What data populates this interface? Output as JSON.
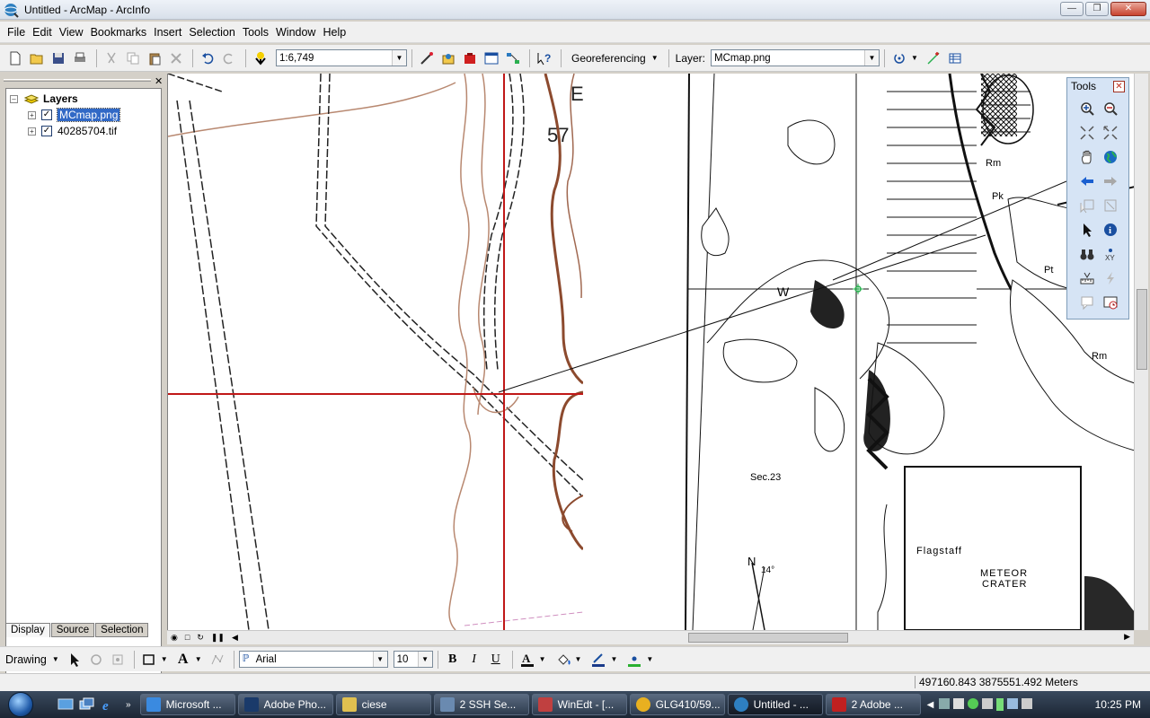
{
  "window": {
    "title": "Untitled - ArcMap - ArcInfo"
  },
  "menu": [
    "File",
    "Edit",
    "View",
    "Bookmarks",
    "Insert",
    "Selection",
    "Tools",
    "Window",
    "Help"
  ],
  "toolbar": {
    "scale": "1:6,749",
    "georef_label": "Georeferencing",
    "layer_label": "Layer:",
    "layer_value": "MCmap.png"
  },
  "toc": {
    "root": "Layers",
    "layers": [
      {
        "name": "MCmap.png",
        "checked": true
      },
      {
        "name": "40285704.tif",
        "checked": true
      }
    ],
    "tabs": [
      "Display",
      "Source",
      "Selection"
    ]
  },
  "tools_window": {
    "title": "Tools"
  },
  "map": {
    "topo_labels": [
      "57",
      "E"
    ],
    "geo_labels": [
      "Rm",
      "Pk",
      "Pt",
      "Rm",
      "W",
      "Sec.23",
      "Flagstaff",
      "METEOR",
      "CRATER",
      "N",
      "14°"
    ]
  },
  "drawbar": {
    "drawing": "Drawing",
    "font": "Arial",
    "size": "10"
  },
  "status": {
    "coords": "497160.843  3875551.492 Meters"
  },
  "taskbar": {
    "items": [
      "Microsoft ...",
      "Adobe Pho...",
      "ciese",
      "2 SSH Se...",
      "WinEdt - [...",
      "GLG410/59...",
      "Untitled - ...",
      "2 Adobe ..."
    ],
    "clock": "10:25 PM"
  }
}
